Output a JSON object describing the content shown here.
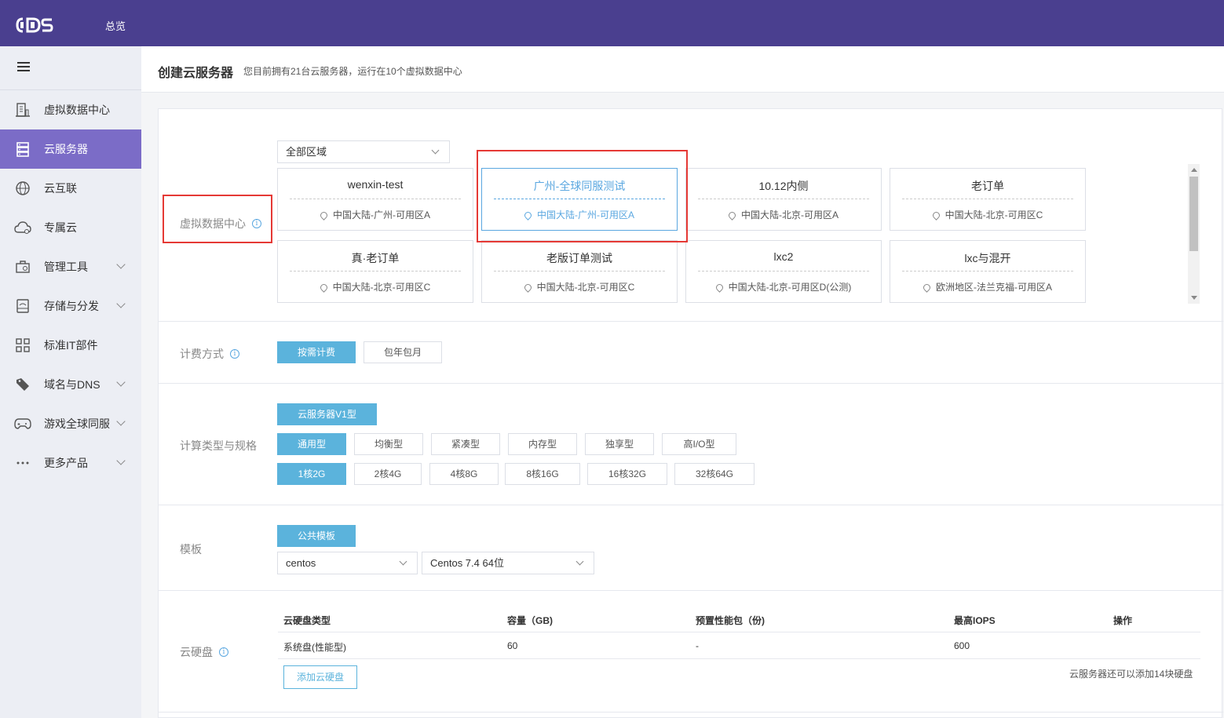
{
  "app": {
    "logo_text": "CDS",
    "nav_overview": "总览"
  },
  "sidebar": {
    "items": [
      {
        "label": "虚拟数据中心",
        "icon": "building-icon"
      },
      {
        "label": "云服务器",
        "icon": "server-icon",
        "active": true
      },
      {
        "label": "云互联",
        "icon": "globe-icon"
      },
      {
        "label": "专属云",
        "icon": "cloud-icon"
      },
      {
        "label": "管理工具",
        "icon": "toolbox-icon",
        "expandable": true
      },
      {
        "label": "存储与分发",
        "icon": "storage-icon",
        "expandable": true
      },
      {
        "label": "标准IT部件",
        "icon": "grid-icon"
      },
      {
        "label": "域名与DNS",
        "icon": "tag-icon",
        "expandable": true
      },
      {
        "label": "游戏全球同服",
        "icon": "gamepad-icon",
        "expandable": true
      },
      {
        "label": "更多产品",
        "icon": "more-icon",
        "expandable": true
      }
    ]
  },
  "header": {
    "title": "创建云服务器",
    "subtitle": "您目前拥有21台云服务器，运行在10个虚拟数据中心"
  },
  "datacenter": {
    "label": "虚拟数据中心",
    "region_select": "全部区域",
    "cards": [
      {
        "name": "wenxin-test",
        "location": "中国大陆-广州-可用区A"
      },
      {
        "name": "广州-全球同服测试",
        "location": "中国大陆-广州-可用区A",
        "selected": true
      },
      {
        "name": "10.12内侧",
        "location": "中国大陆-北京-可用区A"
      },
      {
        "name": "老订单",
        "location": "中国大陆-北京-可用区C"
      },
      {
        "name": "真·老订单",
        "location": "中国大陆-北京-可用区C"
      },
      {
        "name": "老版订单测试",
        "location": "中国大陆-北京-可用区C"
      },
      {
        "name": "lxc2",
        "location": "中国大陆-北京-可用区D(公测)"
      },
      {
        "name": "lxc与混开",
        "location": "欧洲地区-法兰克福-可用区A"
      }
    ]
  },
  "billing": {
    "label": "计费方式",
    "options": [
      "按需计费",
      "包年包月"
    ],
    "selected": "按需计费"
  },
  "compute": {
    "label": "计算类型与规格",
    "family": "云服务器V1型",
    "types": [
      "通用型",
      "均衡型",
      "紧凑型",
      "内存型",
      "独享型",
      "高I/O型"
    ],
    "selected_type": "通用型",
    "specs": [
      "1核2G",
      "2核4G",
      "4核8G",
      "8核16G",
      "16核32G",
      "32核64G"
    ],
    "selected_spec": "1核2G"
  },
  "template": {
    "label": "模板",
    "tab": "公共模板",
    "os": "centos",
    "version": "Centos 7.4 64位"
  },
  "disk": {
    "label": "云硬盘",
    "columns": [
      "云硬盘类型",
      "容量（GB)",
      "预置性能包（份)",
      "最高IOPS",
      "操作"
    ],
    "rows": [
      [
        "系统盘(性能型)",
        "60",
        "-",
        "600",
        ""
      ]
    ],
    "add_button": "添加云硬盘",
    "note": "云服务器还可以添加14块硬盘"
  },
  "colors": {
    "topbar": "#4a3f8f",
    "sidebar_active": "#7b6cc7",
    "primary": "#5bb3dc",
    "highlight": "#e53935"
  }
}
